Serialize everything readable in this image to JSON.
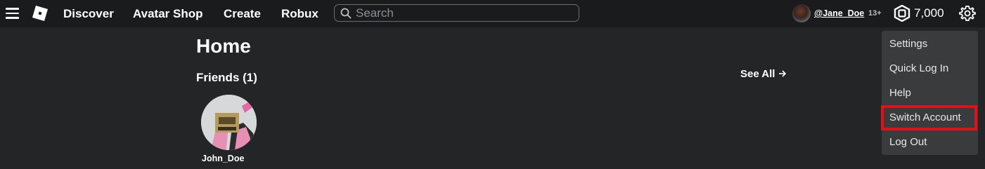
{
  "nav": {
    "links": [
      "Discover",
      "Avatar Shop",
      "Create",
      "Robux"
    ],
    "search_placeholder": "Search"
  },
  "user": {
    "username": "@Jane_Doe",
    "age_badge": "13+",
    "robux": "7,000"
  },
  "home": {
    "title": "Home",
    "friends_title": "Friends (1)",
    "see_all": "See All",
    "friends": [
      {
        "name": "John_Doe"
      }
    ]
  },
  "settings_menu": {
    "items": [
      "Settings",
      "Quick Log In",
      "Help",
      "Switch Account",
      "Log Out"
    ],
    "highlighted": "Switch Account"
  },
  "colors": {
    "background": "#232527",
    "topbar": "#191b1d",
    "dropdown": "#393b3d",
    "highlight_border": "#e3101b"
  }
}
